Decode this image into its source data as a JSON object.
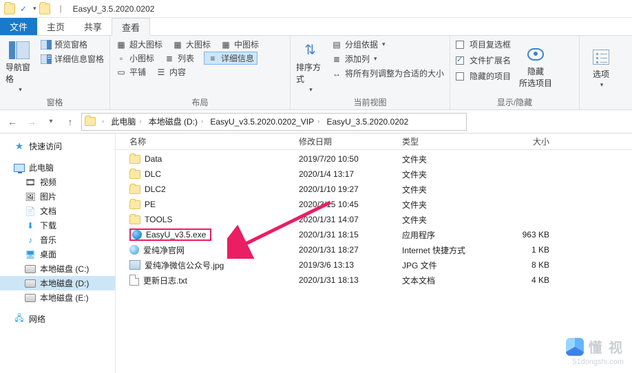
{
  "window": {
    "title": "EasyU_3.5.2020.0202"
  },
  "tabs": {
    "file": "文件",
    "home": "主页",
    "share": "共享",
    "view": "查看"
  },
  "ribbon": {
    "panes": {
      "label": "窗格",
      "nav_pane": "导航窗格",
      "preview_pane": "预览窗格",
      "details_pane": "详细信息窗格"
    },
    "layout": {
      "label": "布局",
      "extra_large": "超大图标",
      "large": "大图标",
      "medium": "中图标",
      "small": "小图标",
      "list": "列表",
      "details": "详细信息",
      "tiles": "平铺",
      "content": "内容"
    },
    "current_view": {
      "label": "当前视图",
      "sort_by": "排序方式",
      "group_by": "分组依据",
      "add_columns": "添加列",
      "size_all_columns": "将所有列调整为合适的大小"
    },
    "show_hide": {
      "label": "显示/隐藏",
      "item_check_boxes": "项目复选框",
      "file_name_ext": "文件扩展名",
      "hidden_items": "隐藏的项目",
      "hide_selected": "隐藏\n所选项目"
    },
    "options": {
      "label": "选项"
    }
  },
  "breadcrumb": {
    "pc": "此电脑",
    "drive": "本地磁盘 (D:)",
    "folder1": "EasyU_v3.5.2020.0202_VIP",
    "folder2": "EasyU_3.5.2020.0202"
  },
  "columns": {
    "name": "名称",
    "date": "修改日期",
    "type": "类型",
    "size": "大小"
  },
  "sidebar": {
    "quick_access": "快速访问",
    "this_pc": "此电脑",
    "videos": "视频",
    "pictures": "图片",
    "documents": "文档",
    "downloads": "下载",
    "music": "音乐",
    "desktop": "桌面",
    "drive_c": "本地磁盘 (C:)",
    "drive_d": "本地磁盘 (D:)",
    "drive_e": "本地磁盘 (E:)",
    "network": "网络"
  },
  "files": [
    {
      "icon": "folder",
      "name": "Data",
      "date": "2019/7/20 10:50",
      "type": "文件夹",
      "size": ""
    },
    {
      "icon": "folder",
      "name": "DLC",
      "date": "2020/1/4 13:17",
      "type": "文件夹",
      "size": ""
    },
    {
      "icon": "folder",
      "name": "DLC2",
      "date": "2020/1/10 19:27",
      "type": "文件夹",
      "size": ""
    },
    {
      "icon": "folder",
      "name": "PE",
      "date": "2020/3/15 10:45",
      "type": "文件夹",
      "size": ""
    },
    {
      "icon": "folder",
      "name": "TOOLS",
      "date": "2020/1/31 14:07",
      "type": "文件夹",
      "size": ""
    },
    {
      "icon": "exe",
      "name": "EasyU_v3.5.exe",
      "date": "2020/1/31 18:15",
      "type": "应用程序",
      "size": "963 KB",
      "highlight": true
    },
    {
      "icon": "net",
      "name": "爱纯净官网",
      "date": "2020/1/31 18:27",
      "type": "Internet 快捷方式",
      "size": "1 KB"
    },
    {
      "icon": "img",
      "name": "爱纯净微信公众号.jpg",
      "date": "2019/3/6 13:13",
      "type": "JPG 文件",
      "size": "8 KB"
    },
    {
      "icon": "txt",
      "name": "更新日志.txt",
      "date": "2020/1/31 18:13",
      "type": "文本文档",
      "size": "4 KB"
    }
  ],
  "watermark": {
    "brand": "懂 视",
    "url": "51dongshi.com"
  }
}
